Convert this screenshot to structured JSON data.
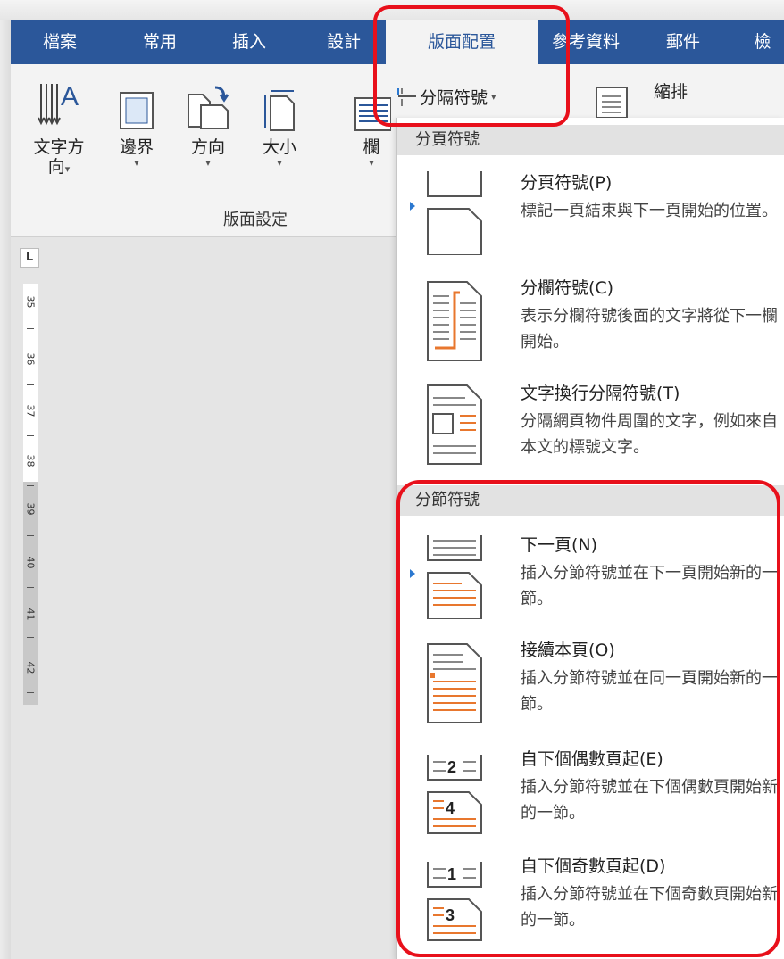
{
  "tabs": [
    "檔案",
    "常用",
    "插入",
    "設計",
    "版面配置",
    "參考資料",
    "郵件",
    "檢"
  ],
  "ribbon": {
    "buttons": [
      {
        "label": "文字方",
        "label2": "向"
      },
      {
        "label": "邊界"
      },
      {
        "label": "方向"
      },
      {
        "label": "大小"
      },
      {
        "label": "欄"
      }
    ],
    "group_label": "版面設定",
    "breaks_button": "分隔符號",
    "wrap_button": "縮排"
  },
  "ruler": {
    "corner": "L",
    "numbers": [
      "35",
      "36",
      "37",
      "38",
      "39",
      "40",
      "41",
      "42"
    ]
  },
  "menu": {
    "page_breaks_header": "分頁符號",
    "section_breaks_header": "分節符號",
    "items": [
      {
        "title": "分頁符號(P)",
        "desc": "標記一頁結束與下一頁開始的位置。"
      },
      {
        "title": "分欄符號(C)",
        "desc": "表示分欄符號後面的文字將從下一欄開始。"
      },
      {
        "title": "文字換行分隔符號(T)",
        "desc": "分隔網頁物件周圍的文字，例如來自本文的標號文字。"
      },
      {
        "title": "下一頁(N)",
        "desc": "插入分節符號並在下一頁開始新的一節。"
      },
      {
        "title": "接續本頁(O)",
        "desc": "插入分節符號並在同一頁開始新的一節。"
      },
      {
        "title": "自下個偶數頁起(E)",
        "desc": "插入分節符號並在下個偶數頁開始新的一節。",
        "icon_nums": [
          "2",
          "4"
        ]
      },
      {
        "title": "自下個奇數頁起(D)",
        "desc": "插入分節符號並在下個奇數頁開始新的一節。",
        "icon_nums": [
          "1",
          "3"
        ]
      }
    ]
  },
  "colors": {
    "ribbon_blue": "#2b579a",
    "highlight_red": "#e8101b",
    "accent_orange": "#e8772e"
  }
}
